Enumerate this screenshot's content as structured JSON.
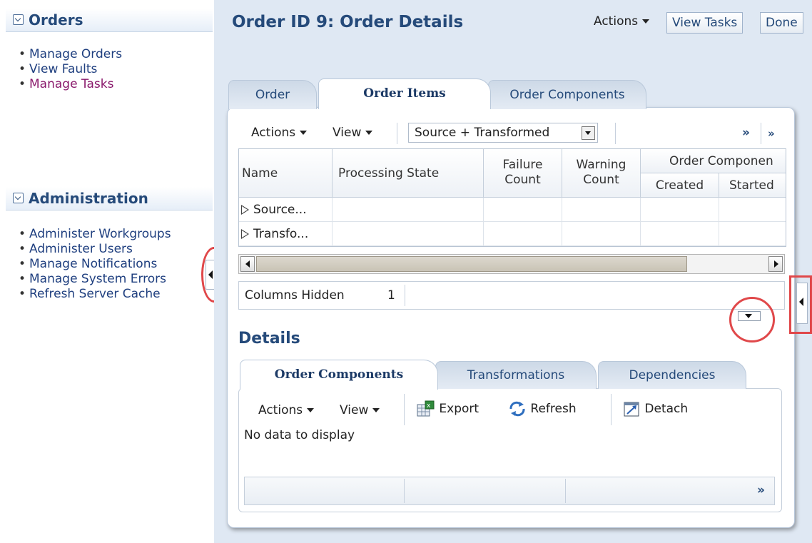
{
  "nav": {
    "orders": {
      "title": "Orders",
      "items": [
        "Manage Orders",
        "View Faults",
        "Manage Tasks"
      ]
    },
    "administration": {
      "title": "Administration",
      "items": [
        "Administer Workgroups",
        "Administer Users",
        "Manage Notifications",
        "Manage System Errors",
        "Refresh Server Cache"
      ]
    }
  },
  "header": {
    "title": "Order ID 9: Order Details",
    "actions_label": "Actions",
    "view_tasks_label": "View Tasks",
    "done_label": "Done"
  },
  "tabs": [
    "Order",
    "Order Items",
    "Order Components"
  ],
  "toolbar": {
    "actions_label": "Actions",
    "view_label": "View",
    "filter_value": "Source + Transformed",
    "overflow_glyph": "»"
  },
  "table": {
    "headers": {
      "name": "Name",
      "processing_state": "Processing State",
      "failure": "Failure",
      "failure2": "Count",
      "warning": "Warning",
      "warning2": "Count",
      "group": "Order Componen",
      "created": "Created",
      "started": "Started"
    },
    "rows": [
      "Source...",
      "Transfo..."
    ]
  },
  "columns_hidden": {
    "label": "Columns Hidden",
    "count": "1"
  },
  "details": {
    "title": "Details",
    "tabs": [
      "Order Components",
      "Transformations",
      "Dependencies"
    ],
    "toolbar": {
      "actions_label": "Actions",
      "view_label": "View",
      "export_label": "Export",
      "refresh_label": "Refresh",
      "detach_label": "Detach"
    },
    "empty_text": "No data to display",
    "footer_overflow": "»"
  },
  "colors": {
    "title": "#254a7a",
    "link": "#1f3f7f",
    "visited_link": "#8a1a6c",
    "highlight": "#e0484a",
    "background": "#dfe8f3"
  }
}
